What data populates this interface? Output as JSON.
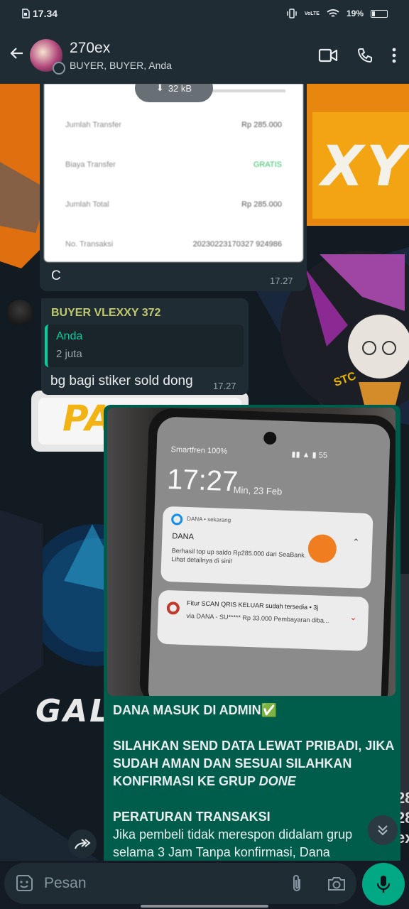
{
  "status_bar": {
    "time": "17.34",
    "battery": "19%",
    "net": "VoLTE"
  },
  "header": {
    "back": "←",
    "name": "270ex",
    "members": "BUYER, BUYER, Anda"
  },
  "receipt": {
    "rows": [
      {
        "label": "Jumlah Transfer",
        "value": "Rp 285.000"
      },
      {
        "label": "Biaya Transfer",
        "value": "GRATIS"
      },
      {
        "label": "Jumlah Total",
        "value": "Rp 285.000"
      },
      {
        "label": "No. Transaksi",
        "value": "20230223170327 924986"
      }
    ],
    "size": "32 kB",
    "caption": "C",
    "time": "17.27"
  },
  "reply": {
    "sender": "BUYER VLEXXY 372",
    "quote_author": "Anda",
    "quote_text": "2 juta",
    "text": "bg bagi stiker sold dong",
    "time": "17.27"
  },
  "photo": {
    "phone_status": "Smartfren 100%",
    "phone_time": "17:27",
    "phone_date": "Min, 23 Feb",
    "n1_app": "DANA • sekarang",
    "n1_title": "DANA",
    "n1_body": "Berhasil top up saldo Rp285.000 dari SeaBank. Lihat detailnya di sini!",
    "n2_title": "Fitur SCAN QRIS KELUAR sudah tersedia • 3j",
    "n2_body": "via DANA - SU***** Rp 33.000 Pembayaran diba..."
  },
  "dana_msg": {
    "line1": "DANA MASUK DI ADMIN✅",
    "line2": "SILAHKAN SEND DATA LEWAT PRIBADI, JIKA SUDAH AMAN DAN SESUAI SILAHKAN KONFIRMASI KE GRUP",
    "line2_italic": "DONE",
    "line3": "PERATURAN TRANSAKSI",
    "line4": "Jika pembeli tidak merespon didalam grup selama 3 Jam Tanpa konfirmasi, Dana"
  },
  "wallpaper": {
    "w1": "XY",
    "w2": "PA",
    "w3": "GAL",
    "w4": "STC"
  },
  "composer": {
    "placeholder": "Pesan"
  },
  "colors": {
    "accent": "#00a884",
    "header": "#1f2c34",
    "bubble_in": "#202c33",
    "bubble_out": "#005c4b",
    "sender": "#c0c96e",
    "quote_bar": "#06cf9c"
  }
}
